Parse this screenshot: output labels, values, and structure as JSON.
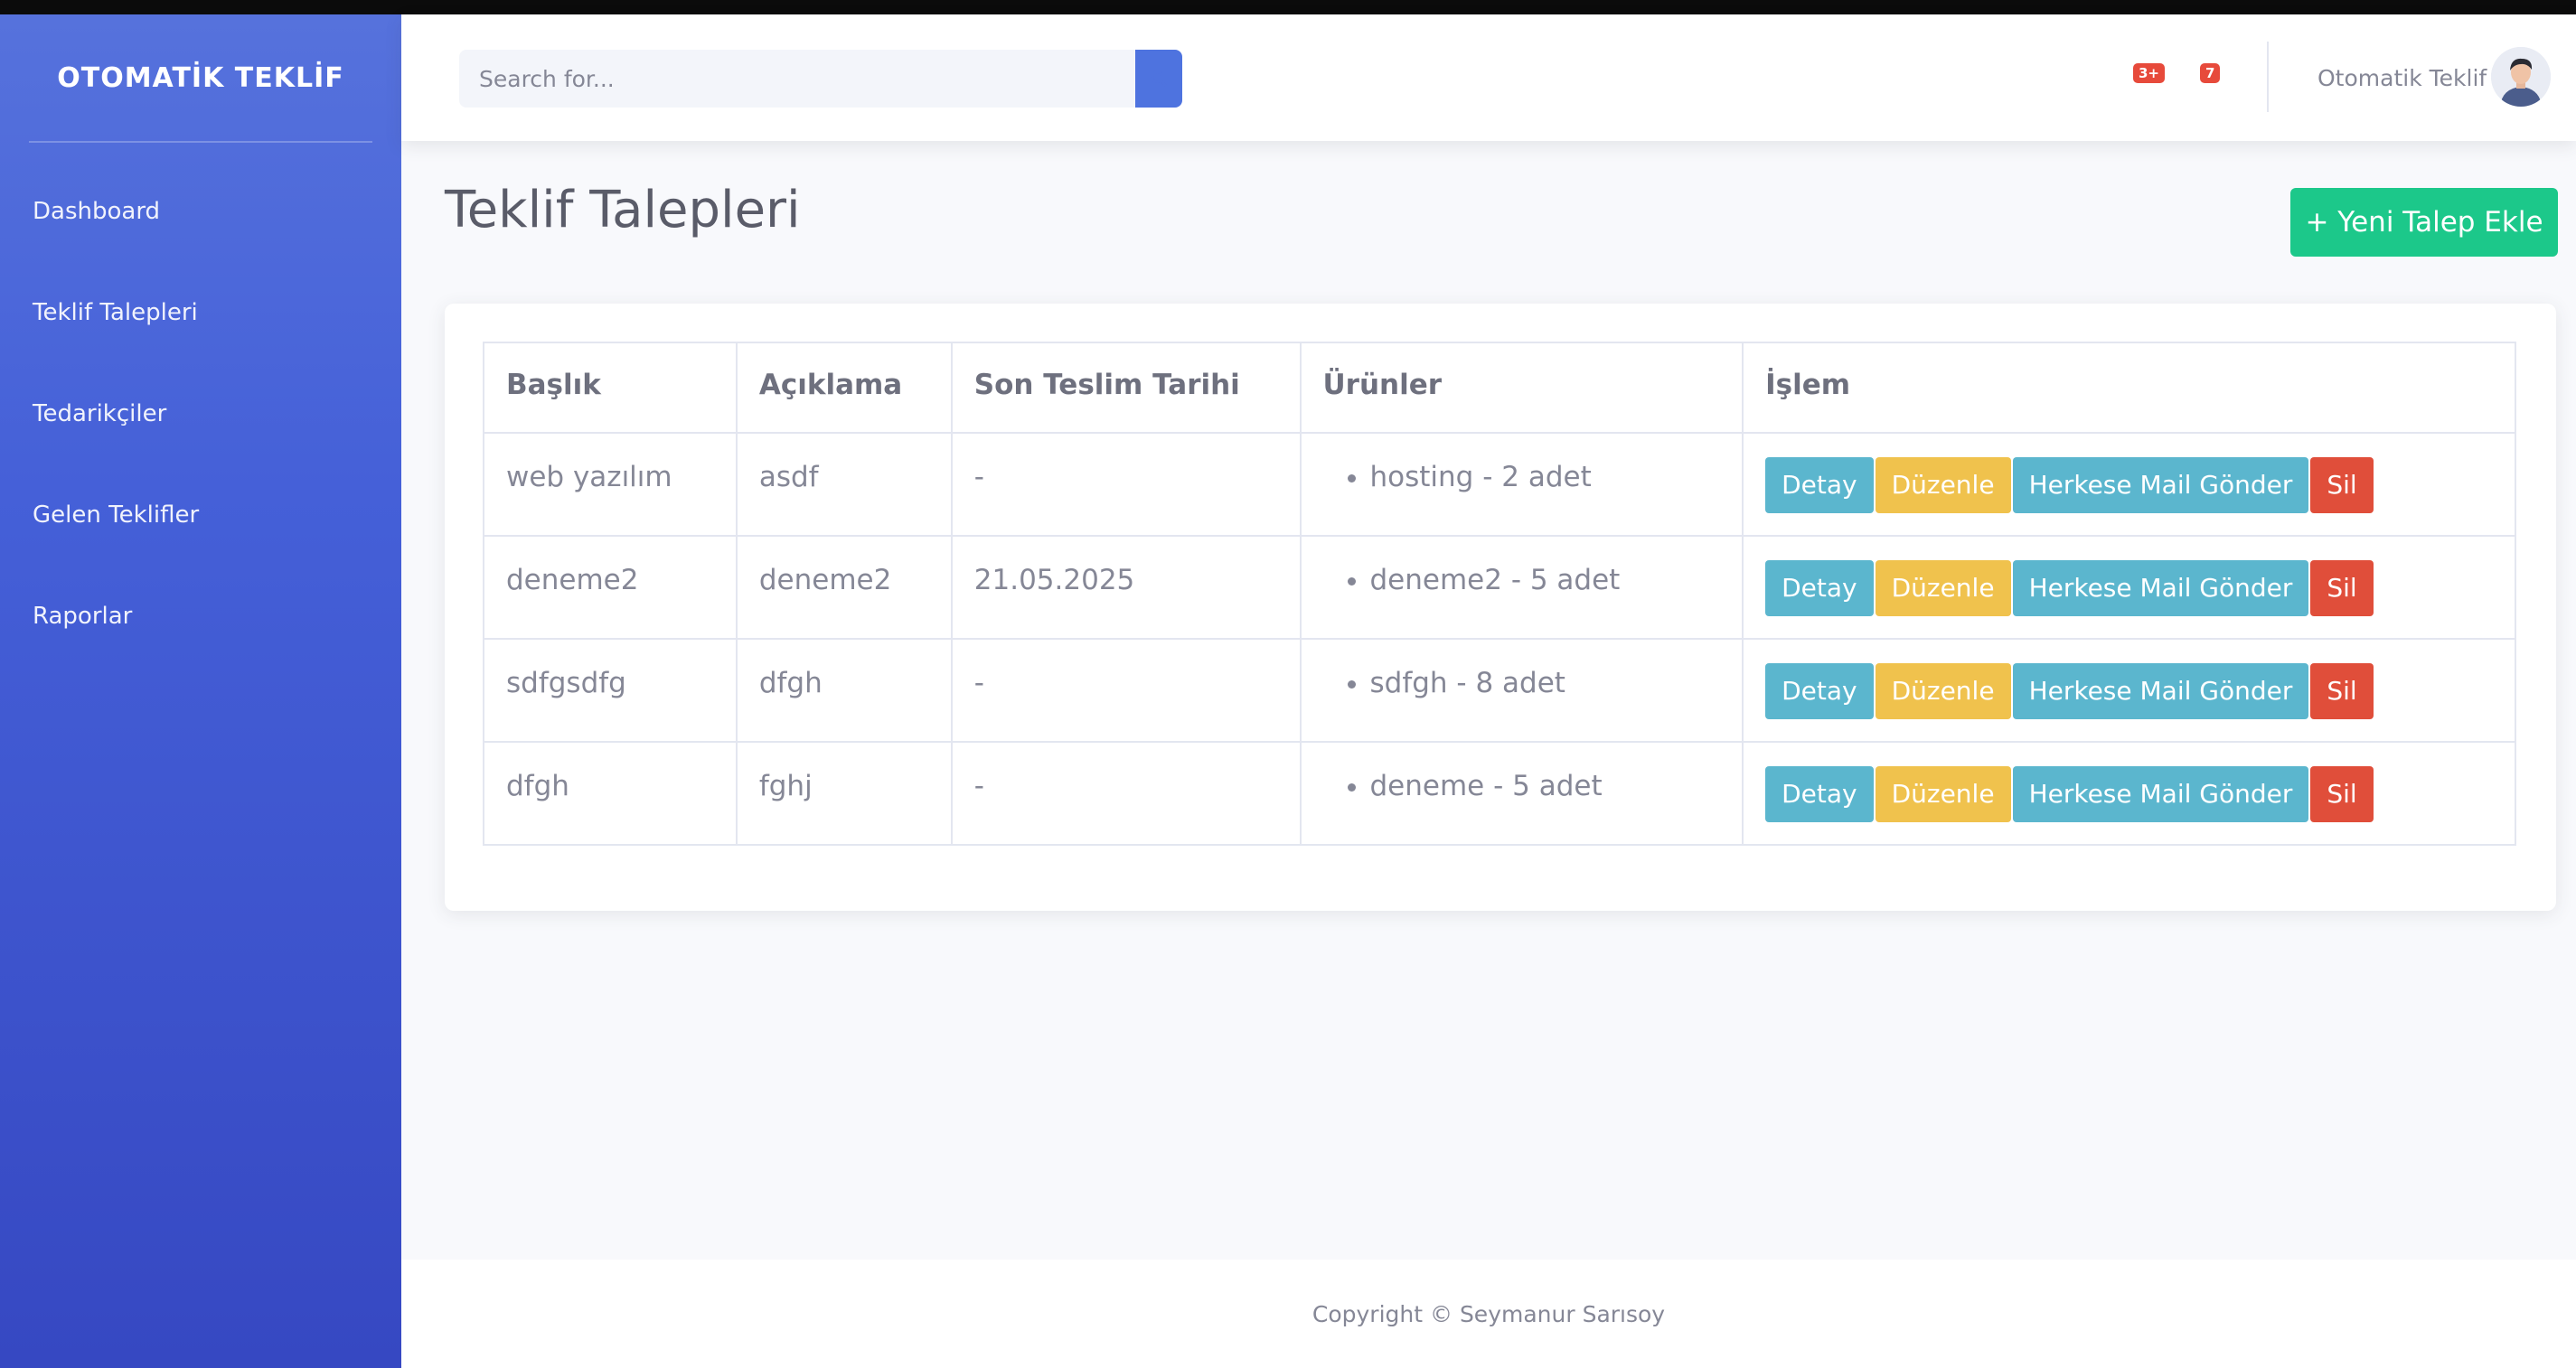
{
  "brand": "OTOMATİK TEKLİF",
  "sidebar": {
    "items": [
      {
        "label": "Dashboard"
      },
      {
        "label": "Teklif Talepleri"
      },
      {
        "label": "Tedarikçiler"
      },
      {
        "label": "Gelen Teklifler"
      },
      {
        "label": "Raporlar"
      }
    ]
  },
  "topbar": {
    "search_placeholder": "Search for...",
    "alerts_badge": "3+",
    "messages_badge": "7",
    "user_name": "Otomatik Teklif"
  },
  "main": {
    "title": "Teklif Talepleri",
    "add_button": "+ Yeni Talep Ekle",
    "table": {
      "headers": [
        "Başlık",
        "Açıklama",
        "Son Teslim Tarihi",
        "Ürünler",
        "İşlem"
      ],
      "rows": [
        {
          "title": "web yazılım",
          "description": "asdf",
          "deadline": "-",
          "products": "hosting - 2 adet"
        },
        {
          "title": "deneme2",
          "description": "deneme2",
          "deadline": "21.05.2025",
          "products": "deneme2 - 5 adet"
        },
        {
          "title": "sdfgsdfg",
          "description": "dfgh",
          "deadline": "-",
          "products": "sdfgh - 8 adet"
        },
        {
          "title": "dfgh",
          "description": "fghj",
          "deadline": "-",
          "products": "deneme - 5 adet"
        }
      ],
      "actions": {
        "detail": "Detay",
        "edit": "Düzenle",
        "mail_all": "Herkese Mail Gönder",
        "delete": "Sil"
      }
    }
  },
  "footer": {
    "copyright": "Copyright © Seymanur Sarısoy"
  },
  "colors": {
    "primary": "#4e73df",
    "success": "#1cc88a",
    "info": "#5bb6ce",
    "warning": "#f0c24d",
    "danger": "#e04e3a"
  }
}
